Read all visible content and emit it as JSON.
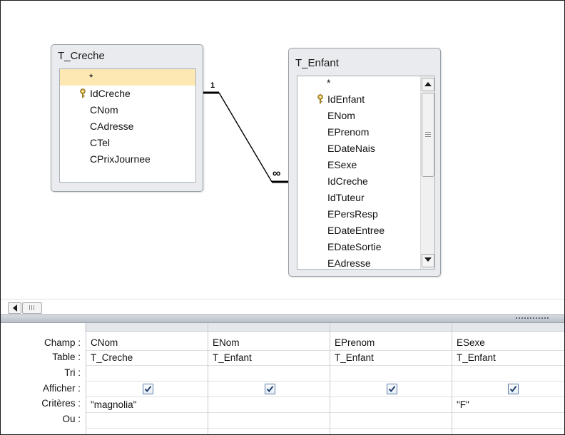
{
  "tables": [
    {
      "name": "T_Creche",
      "fields": [
        {
          "label": "*",
          "key": false,
          "selected": true
        },
        {
          "label": "IdCreche",
          "key": true,
          "selected": false
        },
        {
          "label": "CNom",
          "key": false,
          "selected": false
        },
        {
          "label": "CAdresse",
          "key": false,
          "selected": false
        },
        {
          "label": "CTel",
          "key": false,
          "selected": false
        },
        {
          "label": "CPrixJournee",
          "key": false,
          "selected": false
        }
      ]
    },
    {
      "name": "T_Enfant",
      "fields": [
        {
          "label": "*",
          "key": false
        },
        {
          "label": "IdEnfant",
          "key": true
        },
        {
          "label": "ENom",
          "key": false
        },
        {
          "label": "EPrenom",
          "key": false
        },
        {
          "label": "EDateNais",
          "key": false
        },
        {
          "label": "ESexe",
          "key": false
        },
        {
          "label": "IdCreche",
          "key": false
        },
        {
          "label": "IdTuteur",
          "key": false
        },
        {
          "label": "EPersResp",
          "key": false
        },
        {
          "label": "EDateEntree",
          "key": false
        },
        {
          "label": "EDateSortie",
          "key": false
        },
        {
          "label": "EAdresse",
          "key": false
        }
      ]
    }
  ],
  "relationship": {
    "one_label": "1",
    "many_label": "∞"
  },
  "grid": {
    "row_labels": {
      "field": "Champ :",
      "table": "Table :",
      "sort": "Tri :",
      "show": "Afficher :",
      "criteria": "Critères :",
      "or": "Ou :"
    },
    "columns": [
      {
        "field": "CNom",
        "table": "T_Creche",
        "sort": "",
        "show": true,
        "criteria": "\"magnolia\"",
        "or": ""
      },
      {
        "field": "ENom",
        "table": "T_Enfant",
        "sort": "",
        "show": true,
        "criteria": "",
        "or": ""
      },
      {
        "field": "EPrenom",
        "table": "T_Enfant",
        "sort": "",
        "show": true,
        "criteria": "",
        "or": ""
      },
      {
        "field": "ESexe",
        "table": "T_Enfant",
        "sort": "",
        "show": true,
        "criteria": "\"F\"",
        "or": ""
      }
    ]
  },
  "icons": {
    "key": "key-icon",
    "check": "checkmark-icon",
    "scroll_up": "arrow-up-icon",
    "scroll_down": "arrow-down-icon",
    "scroll_left": "arrow-left-icon"
  }
}
